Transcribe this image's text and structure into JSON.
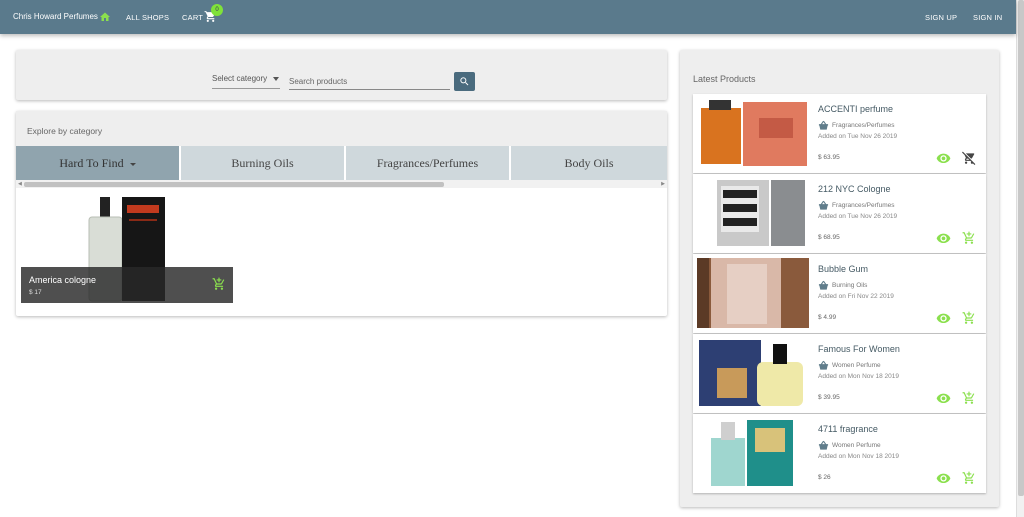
{
  "header": {
    "brand": "Chris Howard Perfumes",
    "home_icon": "home-icon",
    "all_shops": "ALL SHOPS",
    "cart_label": "CART",
    "cart_count": "0",
    "sign_up": "SIGN UP",
    "sign_in": "SIGN IN"
  },
  "search": {
    "category_label": "Select category",
    "placeholder": "Search products",
    "button_icon": "search-icon"
  },
  "explore": {
    "title": "Explore by category",
    "tabs": [
      {
        "label": "Hard To Find"
      },
      {
        "label": "Burning Oils"
      },
      {
        "label": "Fragrances/Perfumes"
      },
      {
        "label": "Body Oils"
      }
    ],
    "featured": {
      "name": "America cologne",
      "price": "$ 17"
    }
  },
  "latest": {
    "title": "Latest Products",
    "items": [
      {
        "name": "ACCENTI perfume",
        "category": "Fragrances/Perfumes",
        "added": "Added on Tue Nov 26 2019",
        "price": "$ 63.95",
        "cart_state": "remove"
      },
      {
        "name": "212 NYC Cologne",
        "category": "Fragrances/Perfumes",
        "added": "Added on Tue Nov 26 2019",
        "price": "$ 68.95",
        "cart_state": "add"
      },
      {
        "name": "Bubble Gum",
        "category": "Burning Oils",
        "added": "Added on Fri Nov 22 2019",
        "price": "$ 4.99",
        "cart_state": "add"
      },
      {
        "name": "Famous For Women",
        "category": "Women Perfume",
        "added": "Added on Mon Nov 18 2019",
        "price": "$ 39.95",
        "cart_state": "add"
      },
      {
        "name": "4711 fragrance",
        "category": "Women Perfume",
        "added": "Added on Mon Nov 18 2019",
        "price": "$ 26",
        "cart_state": "add"
      }
    ]
  },
  "colors": {
    "appbar": "#5a7a8c",
    "accent_green": "#7fe23a",
    "tab_active": "#90a4ae",
    "tab": "#cfd8dc"
  }
}
